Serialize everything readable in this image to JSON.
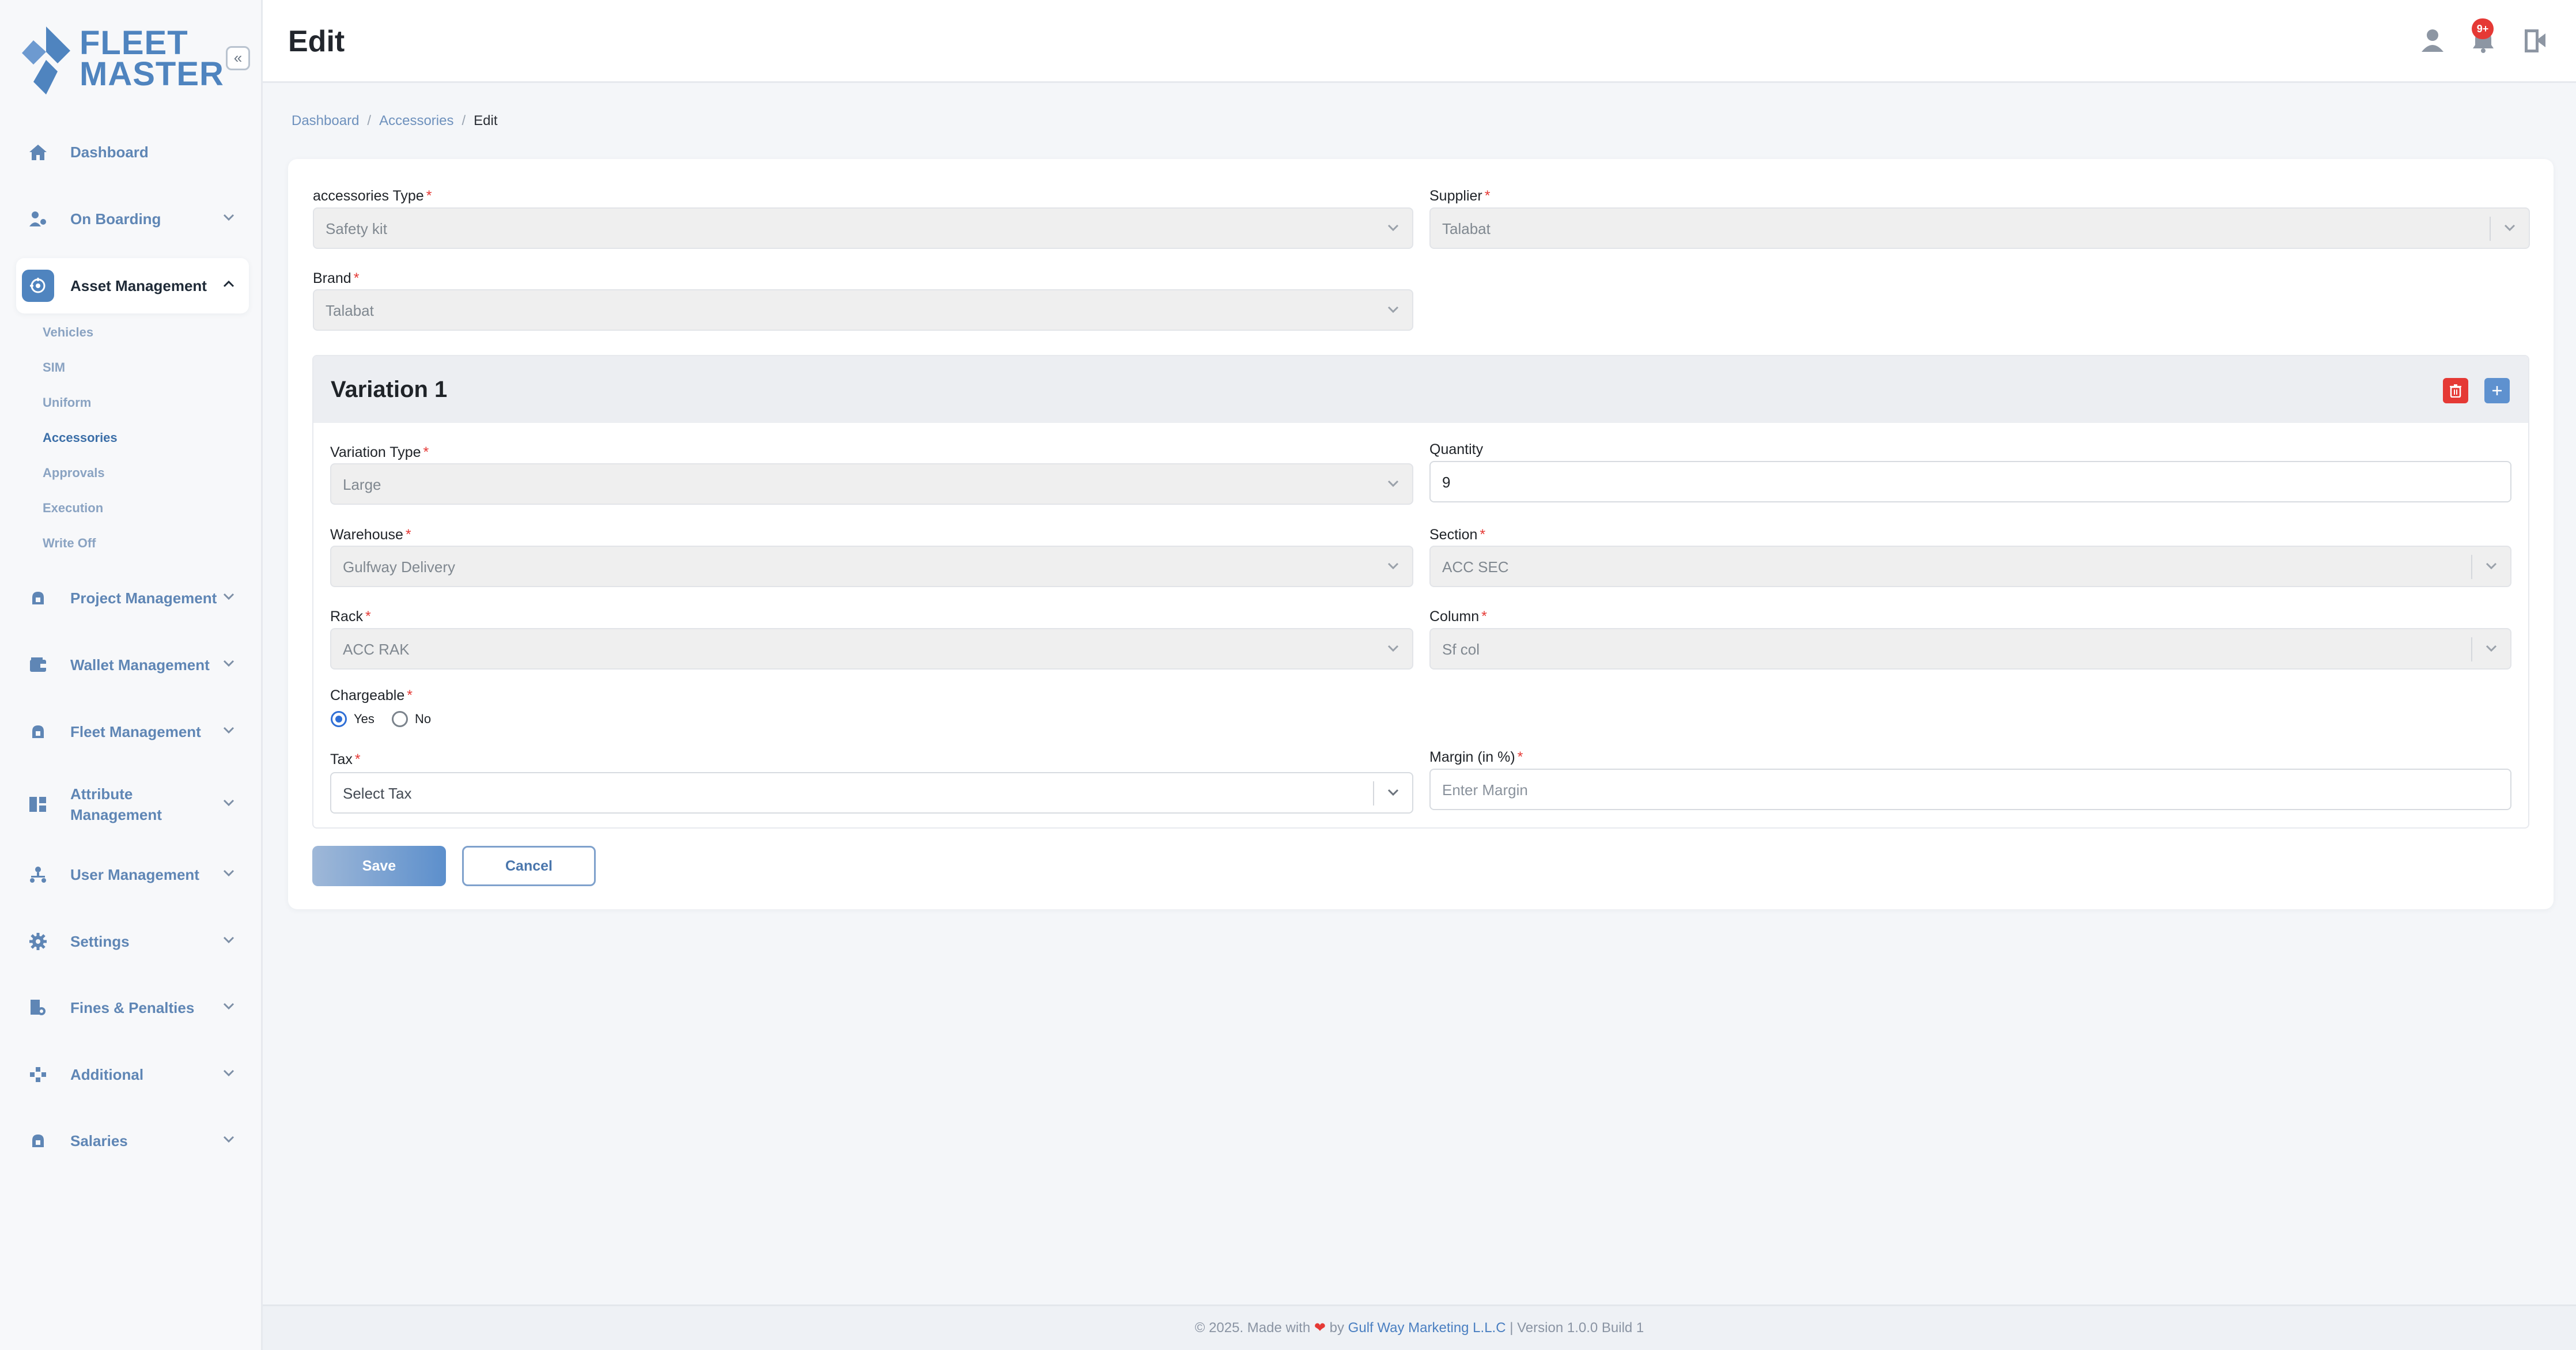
{
  "app": {
    "logo_line1": "FLEET",
    "logo_line2": "MASTER",
    "collapse_icon": "«"
  },
  "colors": {
    "brand": "#4f84bf",
    "required": "#e53935",
    "danger": "#e53935",
    "badge": "#e53935",
    "primary": "#2f6fd6"
  },
  "header": {
    "title": "Edit",
    "notification_count": "9+",
    "icons": [
      "user-icon",
      "bell-icon",
      "logout-icon"
    ]
  },
  "sidebar": {
    "items": [
      {
        "label": "Dashboard",
        "icon": "home-icon"
      },
      {
        "label": "On Boarding",
        "icon": "onboarding-icon"
      },
      {
        "label": "Asset Management",
        "icon": "asset-icon",
        "active": true
      },
      {
        "label": "Project Management",
        "icon": "project-icon"
      },
      {
        "label": "Wallet Management",
        "icon": "wallet-icon"
      },
      {
        "label": "Fleet Management",
        "icon": "fleet-icon"
      },
      {
        "label": "Attribute Management",
        "icon": "attribute-icon"
      },
      {
        "label": "User Management",
        "icon": "users-icon"
      },
      {
        "label": "Settings",
        "icon": "gear-icon"
      },
      {
        "label": "Fines & Penalties",
        "icon": "fines-icon"
      },
      {
        "label": "Additional",
        "icon": "additional-icon"
      },
      {
        "label": "Salaries",
        "icon": "salaries-icon"
      }
    ],
    "asset_sub_items": [
      "Vehicles",
      "SIM",
      "Uniform",
      "Accessories",
      "Approvals",
      "Execution",
      "Write Off"
    ],
    "active_sub_item": "Accessories"
  },
  "breadcrumb": [
    "Dashboard",
    "Accessories",
    "Edit"
  ],
  "form": {
    "accessories_type": {
      "label": "accessories Type",
      "value": "Safety kit"
    },
    "supplier": {
      "label": "Supplier",
      "value": "Talabat"
    },
    "brand": {
      "label": "Brand",
      "value": "Talabat"
    },
    "variation": {
      "title": "Variation 1",
      "variation_type": {
        "label": "Variation Type",
        "value": "Large"
      },
      "quantity": {
        "label": "Quantity",
        "value": "9"
      },
      "warehouse": {
        "label": "Warehouse",
        "value": "Gulfway Delivery"
      },
      "section": {
        "label": "Section",
        "value": "ACC SEC"
      },
      "rack": {
        "label": "Rack",
        "value": "ACC RAK"
      },
      "column": {
        "label": "Column",
        "value": "Sf col"
      },
      "chargeable": {
        "label": "Chargeable",
        "yes": "Yes",
        "no": "No",
        "selected": "Yes"
      },
      "tax": {
        "label": "Tax",
        "placeholder": "Select Tax"
      },
      "margin": {
        "label": "Margin (in %)",
        "placeholder": "Enter Margin"
      }
    },
    "required_mark": "*",
    "save_label": "Save",
    "cancel_label": "Cancel"
  },
  "footer": {
    "prefix": "© 2025. Made with",
    "heart": "❤",
    "by": "by",
    "company": "Gulf Way Marketing L.L.C",
    "version": "| Version 1.0.0 Build 1"
  }
}
